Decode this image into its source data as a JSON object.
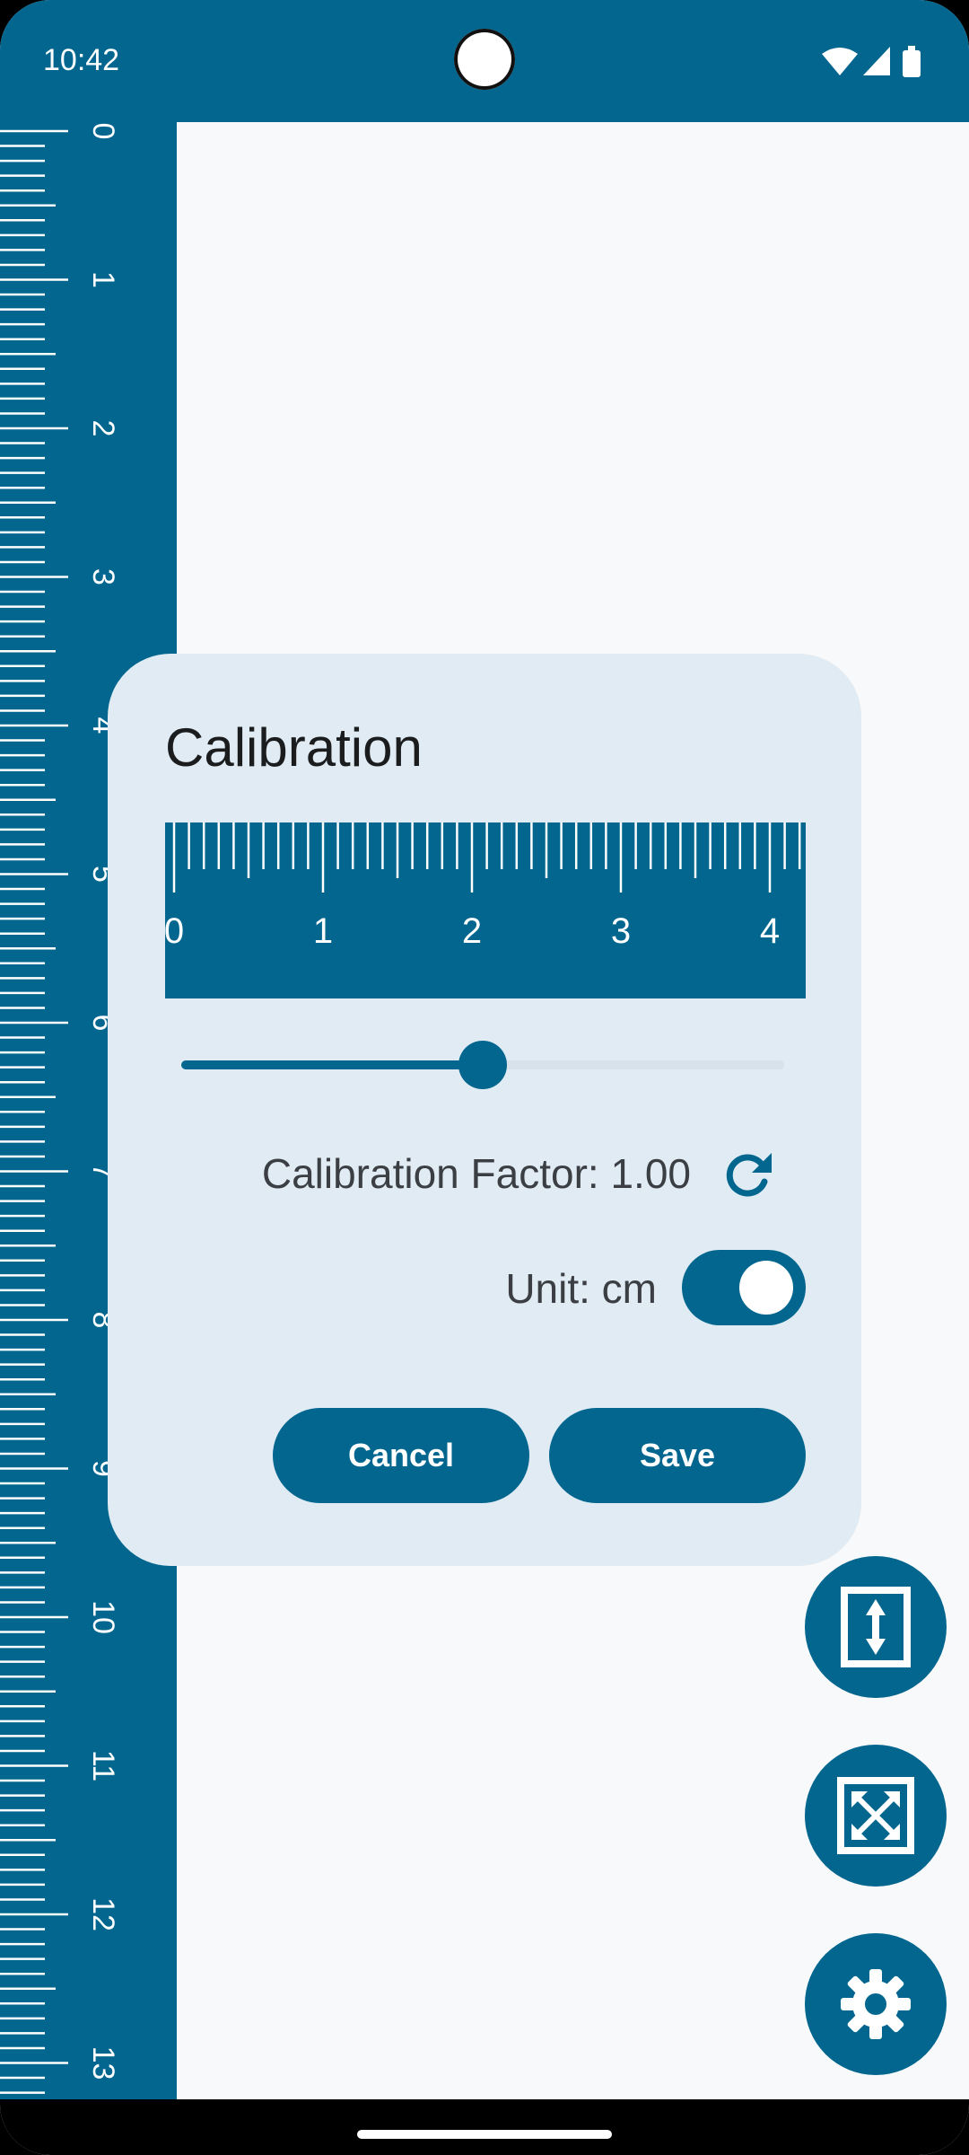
{
  "status_bar": {
    "time": "10:42",
    "icons": [
      "wifi-icon",
      "signal-icon",
      "battery-icon"
    ]
  },
  "ruler": {
    "labels": [
      "0",
      "1",
      "2",
      "3",
      "4",
      "5",
      "6",
      "7",
      "8",
      "9",
      "10",
      "11",
      "12",
      "13"
    ]
  },
  "dialog": {
    "title": "Calibration",
    "preview_ruler": {
      "labels": [
        "0",
        "1",
        "2",
        "3",
        "4"
      ]
    },
    "slider": {
      "value_fraction": 0.5
    },
    "factor_label": "Calibration Factor: 1.00",
    "unit_label": "Unit: cm",
    "unit_toggle_on": true,
    "cancel_label": "Cancel",
    "save_label": "Save"
  },
  "fabs": [
    {
      "icon": "vertical-measure-icon"
    },
    {
      "icon": "fullscreen-measure-icon"
    },
    {
      "icon": "settings-gear-icon"
    }
  ],
  "colors": {
    "primary": "#02668F",
    "dialog_bg": "#E0EBF3",
    "background": "#F8F9FB"
  }
}
